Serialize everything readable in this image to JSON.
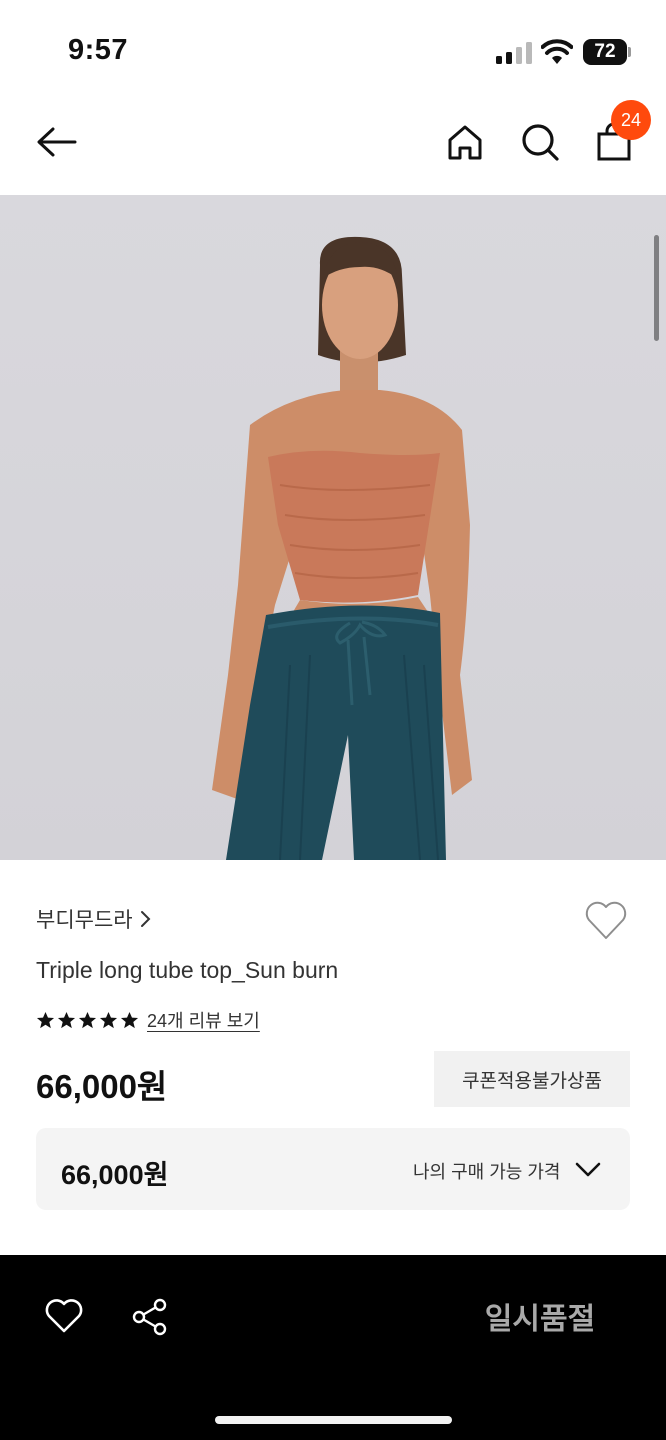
{
  "status_bar": {
    "time": "9:57",
    "battery": "72"
  },
  "nav": {
    "back_icon": "arrow-left-icon",
    "home_icon": "home-icon",
    "search_icon": "search-icon",
    "bag_icon": "shopping-bag-icon",
    "bag_badge": "24",
    "badge_color": "#ff4a0d"
  },
  "product": {
    "brand": "부디무드라",
    "name": "Triple long tube top_Sun burn",
    "rating_stars": 5,
    "review_link": "24개 리뷰 보기",
    "price": "66,000원",
    "coupon_badge": "쿠폰적용불가상품",
    "my_price": "66,000원",
    "my_price_label": "나의 구매 가능 가격"
  },
  "bottom_bar": {
    "wish_icon": "heart-outline-icon",
    "share_icon": "share-icon",
    "action_label": "일시품절"
  },
  "colors": {
    "accent": "#ff4a0d",
    "top": "#c9795a",
    "pants": "#1f4b5a",
    "background_photo": "#d8d7dc"
  }
}
